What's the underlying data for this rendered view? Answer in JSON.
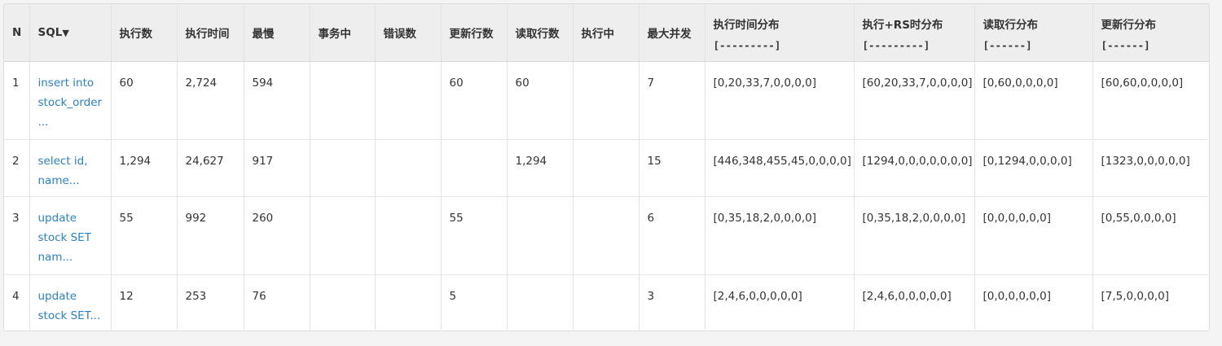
{
  "header": {
    "n": "N",
    "sql": "SQL",
    "sql_sort_icon": "▼",
    "exec_count": "执行数",
    "exec_time": "执行时间",
    "slowest": "最慢",
    "in_txn": "事务中",
    "errors": "错误数",
    "update_rows": "更新行数",
    "read_rows": "读取行数",
    "executing": "执行中",
    "max_concurrent": "最大并发",
    "exec_time_hist": "执行时间分布",
    "exec_time_hist_scale": "[---------]",
    "exec_rs_hist": "执行+RS时分布",
    "exec_rs_hist_scale": "[---------]",
    "read_rows_hist": "读取行分布",
    "read_rows_hist_scale": "[------]",
    "update_rows_hist": "更新行分布",
    "update_rows_hist_scale": "[------]"
  },
  "rows": [
    {
      "n": "1",
      "sql_lines": [
        "insert into",
        "stock_order",
        "..."
      ],
      "exec_count": "60",
      "exec_time": "2,724",
      "slowest": "594",
      "in_txn": "",
      "errors": "",
      "update_rows": "60",
      "read_rows": "60",
      "executing": "",
      "max_concurrent": "7",
      "exec_time_hist": "[0,20,33,7,0,0,0,0]",
      "exec_rs_hist": "[60,20,33,7,0,0,0,0]",
      "read_rows_hist": "[0,60,0,0,0,0]",
      "update_rows_hist": "[60,60,0,0,0,0]"
    },
    {
      "n": "2",
      "sql_lines": [
        "select id,",
        "name..."
      ],
      "exec_count": "1,294",
      "exec_time": "24,627",
      "slowest": "917",
      "in_txn": "",
      "errors": "",
      "update_rows": "",
      "read_rows": "1,294",
      "executing": "",
      "max_concurrent": "15",
      "exec_time_hist": "[446,348,455,45,0,0,0,0]",
      "exec_rs_hist": "[1294,0,0,0,0,0,0,0]",
      "read_rows_hist": "[0,1294,0,0,0,0]",
      "update_rows_hist": "[1323,0,0,0,0,0]"
    },
    {
      "n": "3",
      "sql_lines": [
        "update",
        "stock SET",
        "nam..."
      ],
      "exec_count": "55",
      "exec_time": "992",
      "slowest": "260",
      "in_txn": "",
      "errors": "",
      "update_rows": "55",
      "read_rows": "",
      "executing": "",
      "max_concurrent": "6",
      "exec_time_hist": "[0,35,18,2,0,0,0,0]",
      "exec_rs_hist": "[0,35,18,2,0,0,0,0]",
      "read_rows_hist": "[0,0,0,0,0,0]",
      "update_rows_hist": "[0,55,0,0,0,0]"
    },
    {
      "n": "4",
      "sql_lines": [
        "update",
        "stock SET..."
      ],
      "exec_count": "12",
      "exec_time": "253",
      "slowest": "76",
      "in_txn": "",
      "errors": "",
      "update_rows": "5",
      "read_rows": "",
      "executing": "",
      "max_concurrent": "3",
      "exec_time_hist": "[2,4,6,0,0,0,0,0]",
      "exec_rs_hist": "[2,4,6,0,0,0,0,0]",
      "read_rows_hist": "[0,0,0,0,0,0]",
      "update_rows_hist": "[7,5,0,0,0,0]"
    }
  ],
  "colors": {
    "link": "#2a82c6",
    "header_bg": "#eeeeee",
    "border": "#e2e2e2"
  }
}
